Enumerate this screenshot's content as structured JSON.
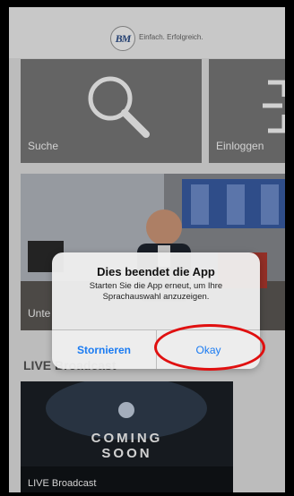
{
  "header": {
    "logo_text": "BM",
    "tagline": "Einfach. Erfolgreich."
  },
  "tiles": {
    "search_label": "Suche",
    "login_label": "Einloggen",
    "video_label_partial": "Unte"
  },
  "sections": {
    "live_title": "LIVE Broadcast"
  },
  "live_tile": {
    "coming_line1": "COMING",
    "coming_line2": "SOON",
    "label": "LIVE Broadcast"
  },
  "alert": {
    "title": "Dies beendet die App",
    "message": "Starten Sie die App erneut, um Ihre Sprachauswahl anzuzeigen.",
    "cancel_label": "Stornieren",
    "ok_label": "Okay"
  },
  "colors": {
    "tile": "#7b7b7b",
    "ios_blue": "#1a7bf2",
    "annotation_red": "#e01010"
  },
  "icons": [
    "search-icon",
    "login-icon",
    "logo-icon"
  ]
}
